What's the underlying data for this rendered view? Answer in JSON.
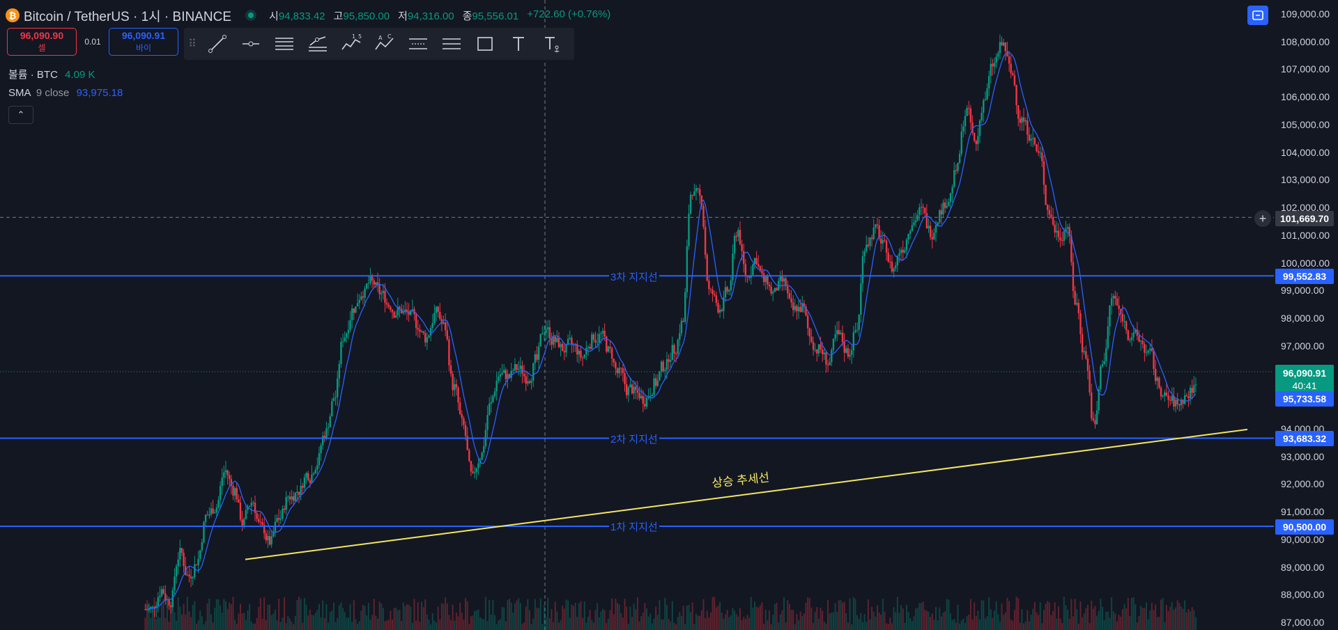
{
  "header": {
    "logo_glyph": "₿",
    "symbol": "Bitcoin / TetherUS · 1시 · BINANCE",
    "ohlc": [
      {
        "label": "시",
        "value": "94,833.42"
      },
      {
        "label": "고",
        "value": "95,850.00"
      },
      {
        "label": "저",
        "value": "94,316.00"
      },
      {
        "label": "종",
        "value": "95,556.01"
      },
      {
        "label": "",
        "value": "+722.60 (+0.76%)"
      }
    ]
  },
  "trade": {
    "sell_price": "96,090.90",
    "sell_label": "셀",
    "spread": "0.01",
    "buy_price": "96,090.91",
    "buy_label": "바이"
  },
  "toolbar": {
    "drag_glyph": "⠿",
    "tools": [
      "trend-line-icon",
      "horizontal-ray-icon",
      "parallel-lines-icon",
      "fib-icon",
      "wave-15-icon",
      "wave-abc-icon",
      "range-icon",
      "date-range-icon",
      "rectangle-icon",
      "text-icon",
      "anchored-text-icon"
    ]
  },
  "legend": {
    "volume": {
      "label": "볼륨 · BTC",
      "value": "4.09 K"
    },
    "sma": {
      "label": "SMA",
      "params": "9 close",
      "value": "93,975.18"
    },
    "collapse_glyph": "⌃"
  },
  "colors": {
    "background": "#131722",
    "up": "#089981",
    "down": "#f23645",
    "sma": "#2962ff",
    "support": "#2962ff",
    "trendline": "#f5e663"
  },
  "chart_data": {
    "type": "candlestick",
    "title": "Bitcoin / TetherUS · 1시 · BINANCE",
    "ylim": [
      86500,
      109500
    ],
    "y_ticks": [
      "109,000.00",
      "108,000.00",
      "107,000.00",
      "106,000.00",
      "105,000.00",
      "104,000.00",
      "103,000.00",
      "102,000.00",
      "101,000.00",
      "100,000.00",
      "99,000.00",
      "98,000.00",
      "97,000.00",
      "96,000.00",
      "95,000.00",
      "94,000.00",
      "93,000.00",
      "92,000.00",
      "91,000.00",
      "90,000.00",
      "89,000.00",
      "88,000.00",
      "87,000.00"
    ],
    "grid": false,
    "price_series_approx": {
      "name": "close",
      "values": [
        87500,
        88200,
        87800,
        89500,
        88700,
        89300,
        90900,
        91200,
        92500,
        91800,
        90600,
        91400,
        90400,
        89900,
        90800,
        91600,
        91800,
        92400,
        92800,
        93900,
        95200,
        97400,
        98400,
        99000,
        99300,
        98900,
        98500,
        98300,
        98200,
        97800,
        97300,
        98200,
        97700,
        95500,
        94100,
        92200,
        93100,
        94900,
        96000,
        95900,
        96200,
        95900,
        96500,
        97700,
        97200,
        96900,
        97000,
        96600,
        97200,
        97400,
        96800,
        96000,
        95400,
        95300,
        95100,
        95700,
        96300,
        96900,
        97900,
        102700,
        102300,
        98900,
        98400,
        99000,
        101200,
        99500,
        100200,
        99300,
        98900,
        99300,
        98300,
        98400,
        97300,
        96900,
        96400,
        97400,
        96800,
        97600,
        100800,
        101200,
        100600,
        99800,
        100600,
        101500,
        101900,
        101200,
        101800,
        102300,
        103400,
        105500,
        104300,
        106000,
        107200,
        107900,
        106800,
        105200,
        104700,
        103900,
        101900,
        101100,
        101400,
        98500,
        96700,
        94100,
        96600,
        98800,
        98100,
        97400,
        97200,
        96700,
        95600,
        95100,
        94900,
        95200,
        95556
      ]
    },
    "sma9_last": 93975.18,
    "current_price": 96090.91,
    "horizontal_lines": [
      {
        "name": "3차 지지선",
        "price": 99552.83,
        "badge": "99,552.83"
      },
      {
        "name": "2차 지지선",
        "price": 93683.32,
        "badge": "93,683.32"
      },
      {
        "name": "1차 지지선",
        "price": 90500.0,
        "badge": "90,500.00"
      }
    ],
    "trend_line": {
      "name": "상승 추세선",
      "from_price": 89300,
      "to_price": 94000
    },
    "crosshair_price": "101,669.70",
    "price_badge": {
      "price": "96,090.91",
      "countdown": "40:41"
    },
    "sma_badge": "95,733.58"
  }
}
